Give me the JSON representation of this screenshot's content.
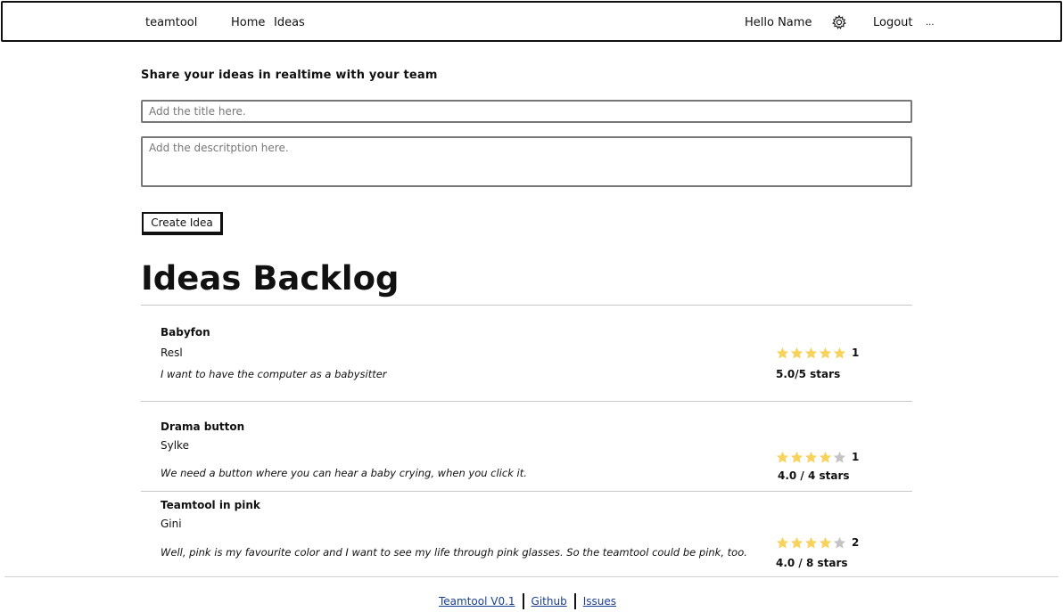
{
  "nav": {
    "brand": "teamtool",
    "links": [
      "Home",
      "Ideas"
    ],
    "greeting": "Hello Name",
    "settings_icon": "gear-icon",
    "logout": "Logout",
    "more": "..."
  },
  "form": {
    "tagline": "Share your ideas in realtime with your team",
    "title_placeholder": "Add the title here.",
    "description_placeholder": "Add the descritption here.",
    "create_label": "Create Idea"
  },
  "backlog": {
    "heading": "Ideas Backlog",
    "star_colors": {
      "filled": "#f7d35c",
      "empty": "#c4c4c4"
    },
    "ideas": [
      {
        "title": "Babyfon",
        "author": "Resl",
        "description": "I want to have the computer as a babysitter",
        "stars": 5,
        "count": "1",
        "rating_text": "5.0/5 stars"
      },
      {
        "title": "Drama button",
        "author": "Sylke",
        "description": "We need a button where you can hear a baby crying, when you click it.",
        "stars": 4,
        "count": "1",
        "rating_text": "4.0 / 4 stars"
      },
      {
        "title": "Teamtool in pink",
        "author": "Gini",
        "description": "Well, pink is my favourite color and I want to see my life through pink glasses. So the teamtool could be pink, too.",
        "stars": 4,
        "count": "2",
        "rating_text": "4.0 / 8 stars"
      }
    ]
  },
  "footer": {
    "links": [
      "Teamtool V0.1",
      "Github",
      "Issues"
    ]
  }
}
